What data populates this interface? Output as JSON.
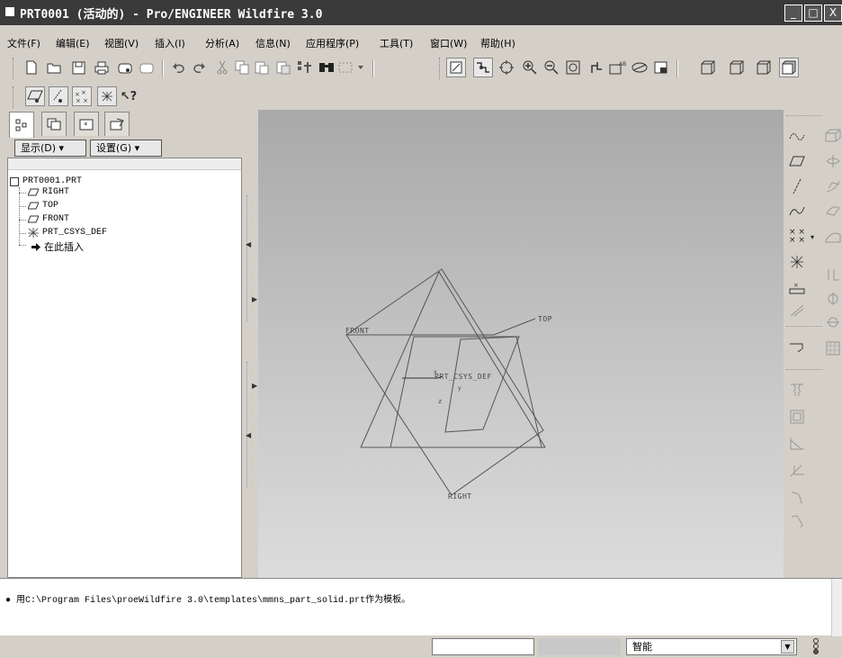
{
  "window": {
    "title": "PRT0001 (活动的) - Pro/ENGINEER Wildfire 3.0",
    "minimize": "_",
    "maximize": "□",
    "close": "X"
  },
  "menu": [
    "文件(F)",
    "编辑(E)",
    "视图(V)",
    "插入(I)",
    "分析(A)",
    "信息(N)",
    "应用程序(P)",
    "工具(T)",
    "窗口(W)",
    "帮助(H)"
  ],
  "navigator": {
    "display_button": "显示(D) ▾",
    "settings_button": "设置(G) ▾"
  },
  "model_tree": {
    "root": "PRT0001.PRT",
    "items": [
      "RIGHT",
      "TOP",
      "FRONT",
      "PRT_CSYS_DEF",
      "在此插入"
    ]
  },
  "datum_labels": {
    "front": "FRONT",
    "top": "TOP",
    "right": "RIGHT",
    "csys": "PRT_CSYS_DEF",
    "axis_x": "x",
    "axis_y": "y",
    "axis_z": "z"
  },
  "message": "● 用C:\\Program Files\\proeWildfire 3.0\\templates\\mmns_part_solid.prt作为模板。",
  "status": {
    "filter_value": "智能"
  },
  "icons": {
    "toolbar_file": [
      "new-icon",
      "open-icon",
      "save-icon",
      "print-icon",
      "send-mail-icon",
      "send-link-icon"
    ],
    "toolbar_edit": [
      "undo-icon",
      "redo-icon",
      "cut-icon",
      "copy-icon",
      "paste-icon",
      "paste-special-icon",
      "regenerate-icon",
      "find-icon",
      "select-box-icon"
    ],
    "toolbar_view": [
      "redraw-icon",
      "spin-center-icon",
      "orient-icon",
      "zoom-in-icon",
      "zoom-out-icon",
      "refit-icon",
      "reorient-icon",
      "saved-views-icon",
      "layers-icon",
      "view-manager-icon"
    ],
    "toolbar_display": [
      "wireframe-icon",
      "hidden-line-icon",
      "no-hidden-icon",
      "shading-icon"
    ],
    "datum_display": [
      "plane-display-icon",
      "axis-display-icon",
      "point-display-icon",
      "csys-display-icon",
      "whats-this-icon"
    ],
    "navigator_tabs": [
      "model-tree-tab-icon",
      "folder-browser-tab-icon",
      "favorites-tab-icon",
      "web-tab-icon"
    ],
    "right_col1": [
      "sketch-datum-icon",
      "datum-plane-icon",
      "datum-axis-icon",
      "datum-curve-icon",
      "datum-point-icon",
      "datum-csys-icon",
      "analysis-feature-icon",
      "annotation-icon",
      "mirror-tool-icon",
      "hole-icon",
      "shell-icon",
      "rib-icon",
      "draft-icon",
      "round-icon",
      "chamfer-icon"
    ],
    "right_col2": [
      "extrude-icon",
      "revolve-icon",
      "sweep-icon",
      "blend-icon",
      "style-icon",
      "merge-icon",
      "trim-icon",
      "offset-icon",
      "pattern-icon"
    ]
  }
}
